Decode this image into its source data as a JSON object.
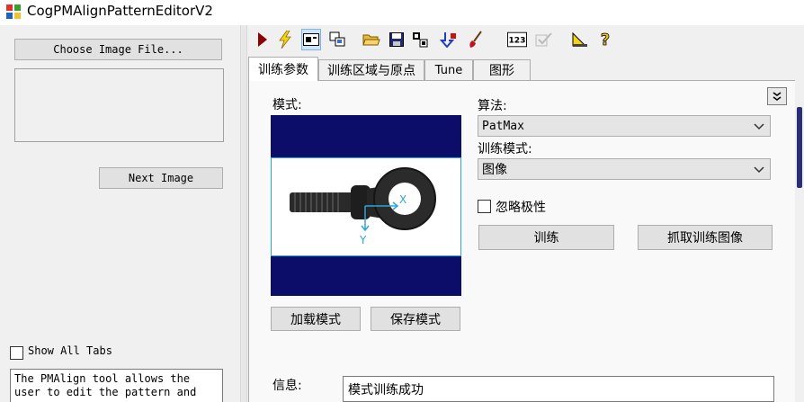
{
  "window": {
    "title": "CogPMAlignPatternEditorV2"
  },
  "left": {
    "choose_label": "Choose Image File...",
    "next_label": "Next Image",
    "show_all_label": "Show All Tabs",
    "description": "The PMAlign tool allows the user to edit the pattern and"
  },
  "tabs": [
    "训练参数",
    "训练区域与原点",
    "Tune",
    "图形"
  ],
  "train": {
    "pattern_label": "模式:",
    "algorithm_label": "算法:",
    "algorithm_value": "PatMax",
    "mode_label": "训练模式:",
    "mode_value": "图像",
    "ignore_polarity": "忽略极性",
    "train_button": "训练",
    "grab_button": "抓取训练图像",
    "load_button": "加载模式",
    "save_button": "保存模式",
    "info_label": "信息:",
    "info_value": "模式训练成功",
    "axis_x": "X",
    "axis_y": "Y"
  },
  "toolbar": {
    "numeric_badge": "123"
  },
  "colors": {
    "image_background": "#0c0c69",
    "selection_highlight": "#2ba6d8",
    "active_tool": "#cce4f7"
  }
}
